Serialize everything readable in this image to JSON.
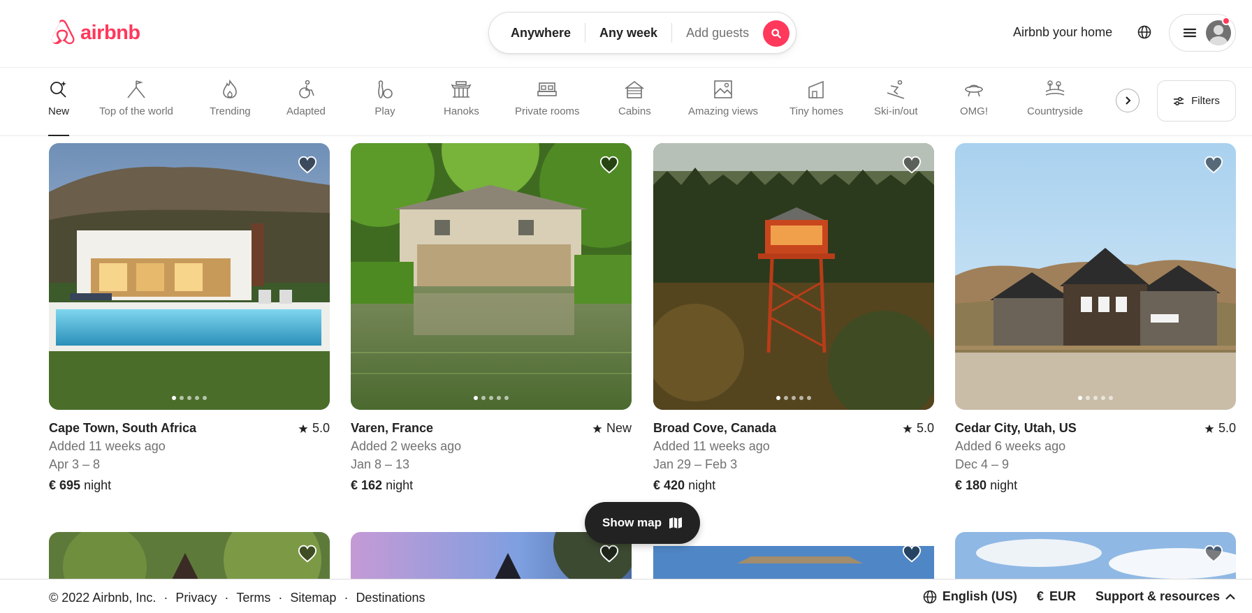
{
  "header": {
    "logo_text": "airbnb",
    "search": {
      "anywhere": "Anywhere",
      "any_week": "Any week",
      "add_guests": "Add guests"
    },
    "host_link": "Airbnb your home"
  },
  "categories": [
    {
      "label": "New",
      "icon": "new-sparkle-icon",
      "active": true
    },
    {
      "label": "Top of the world",
      "icon": "mountain-flag-icon"
    },
    {
      "label": "Trending",
      "icon": "flame-icon"
    },
    {
      "label": "Adapted",
      "icon": "wheelchair-icon"
    },
    {
      "label": "Play",
      "icon": "bowling-icon"
    },
    {
      "label": "Hanoks",
      "icon": "hanok-icon"
    },
    {
      "label": "Private rooms",
      "icon": "bed-icon"
    },
    {
      "label": "Cabins",
      "icon": "cabin-icon"
    },
    {
      "label": "Amazing views",
      "icon": "picture-icon"
    },
    {
      "label": "Tiny homes",
      "icon": "tiny-home-icon"
    },
    {
      "label": "Ski-in/out",
      "icon": "skier-icon"
    },
    {
      "label": "OMG!",
      "icon": "ufo-icon"
    },
    {
      "label": "Countryside",
      "icon": "countryside-icon"
    }
  ],
  "filters_label": "Filters",
  "listings": [
    {
      "location": "Cape Town, South Africa",
      "rating": "5.0",
      "added": "Added 11 weeks ago",
      "dates": "Apr 3 – 8",
      "price": "€ 695",
      "unit": "night"
    },
    {
      "location": "Varen, France",
      "rating": "New",
      "added": "Added 2 weeks ago",
      "dates": "Jan 8 – 13",
      "price": "€ 162",
      "unit": "night"
    },
    {
      "location": "Broad Cove, Canada",
      "rating": "5.0",
      "added": "Added 11 weeks ago",
      "dates": "Jan 29 – Feb 3",
      "price": "€ 420",
      "unit": "night"
    },
    {
      "location": "Cedar City, Utah, US",
      "rating": "5.0",
      "added": "Added 6 weeks ago",
      "dates": "Dec 4 – 9",
      "price": "€ 180",
      "unit": "night"
    }
  ],
  "show_map": "Show map",
  "footer": {
    "copyright": "© 2022 Airbnb, Inc.",
    "links": [
      "Privacy",
      "Terms",
      "Sitemap",
      "Destinations"
    ],
    "separator": "·",
    "language": "English (US)",
    "currency_symbol": "€",
    "currency": "EUR",
    "support": "Support & resources"
  },
  "colors": {
    "brand": "#ff385c",
    "text": "#222222",
    "muted": "#717171"
  }
}
